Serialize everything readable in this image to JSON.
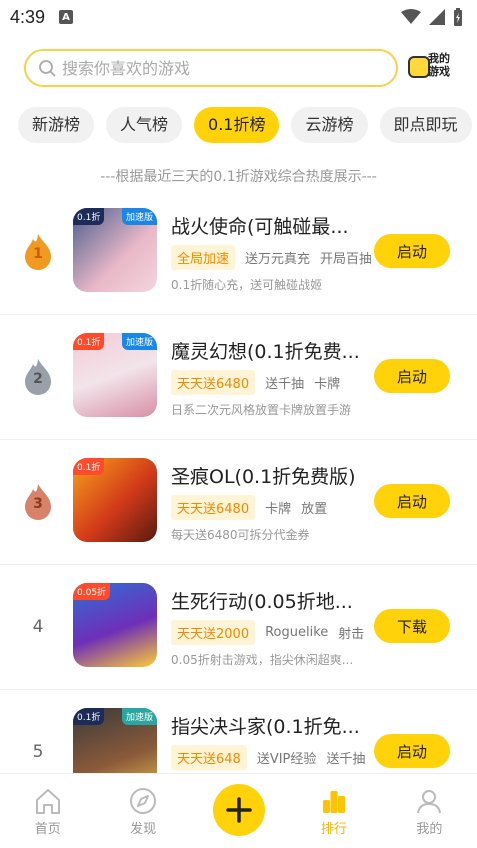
{
  "status": {
    "time": "4:39",
    "a_badge": "A"
  },
  "search": {
    "placeholder": "搜索你喜欢的游戏",
    "my_games_label": "我的游戏"
  },
  "tabs": [
    {
      "label": "新游榜"
    },
    {
      "label": "人气榜"
    },
    {
      "label": "0.1折榜",
      "active": true
    },
    {
      "label": "云游榜"
    },
    {
      "label": "即点即玩"
    }
  ],
  "subtitle": "---根据最近三天的0.1折游戏综合热度展示---",
  "games": [
    {
      "rank": "1",
      "thumb_tl": "0.1折",
      "thumb_tr": "加速版",
      "title": "战火使命(可触碰最...",
      "tag_highlight": "全局加速",
      "tags": [
        "送万元真充",
        "开局百抽"
      ],
      "desc": "0.1折随心充，送可触碰战姬",
      "action": "启动",
      "flame_color": "#f29a1f"
    },
    {
      "rank": "2",
      "thumb_tl": "0.1折",
      "thumb_tr": "加速版",
      "title": "魔灵幻想(0.1折免费...",
      "tag_highlight": "天天送6480",
      "tags": [
        "送千抽",
        "卡牌"
      ],
      "desc": "日系二次元风格放置卡牌放置手游",
      "action": "启动",
      "flame_color": "#9aa0aa"
    },
    {
      "rank": "3",
      "thumb_tl": "0.1折",
      "thumb_tr": "",
      "title": "圣痕OL(0.1折免费版)",
      "tag_highlight": "天天送6480",
      "tags": [
        "卡牌",
        "放置"
      ],
      "desc": "每天送6480可拆分代金券",
      "action": "启动",
      "flame_color": "#d9826a"
    },
    {
      "rank": "4",
      "thumb_tl": "0.05折",
      "thumb_tr": "",
      "title": "生死行动(0.05折地...",
      "tag_highlight": "天天送2000",
      "tags": [
        "Roguelike",
        "射击"
      ],
      "desc": "0.05折射击游戏，指尖休闲超爽...",
      "action": "下载",
      "flame_color": ""
    },
    {
      "rank": "5",
      "thumb_tl": "0.1折",
      "thumb_tr": "加速版",
      "title": "指尖决斗家(0.1折免...",
      "tag_highlight": "天天送648",
      "tags": [
        "送VIP经验",
        "送千抽"
      ],
      "desc": "",
      "action": "启动",
      "flame_color": ""
    }
  ],
  "nav": [
    {
      "label": "首页",
      "icon": "home-icon"
    },
    {
      "label": "发现",
      "icon": "compass-icon"
    },
    {
      "label": "",
      "icon": "plus-icon"
    },
    {
      "label": "排行",
      "icon": "ranking-icon",
      "active": true
    },
    {
      "label": "我的",
      "icon": "profile-icon"
    }
  ],
  "colors": {
    "accent": "#ffd20a",
    "tag_text": "#f08a00",
    "tag_bg": "#fff4d6",
    "search_border": "#f7d24a"
  }
}
